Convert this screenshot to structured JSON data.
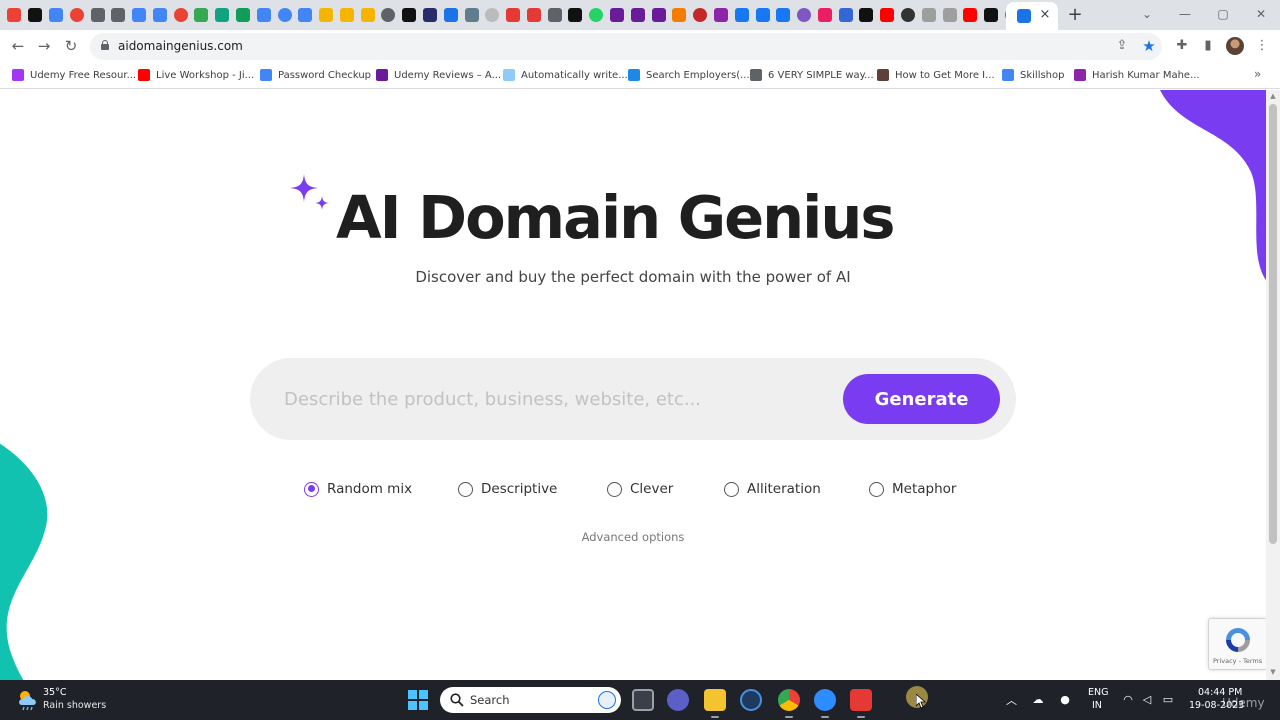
{
  "browser": {
    "tab_favicon_colors": [
      "#ea4335",
      "#111111",
      "#4285f4",
      "#ea4335",
      "#5f6368",
      "#5f6368",
      "#4285f4",
      "#4285f4",
      "#ea4335",
      "#34a853",
      "#10a37f",
      "#0f9d58",
      "#4285f4",
      "#4285f4",
      "#4285f4",
      "#f4b400",
      "#f4b400",
      "#f4b400",
      "#5f6368",
      "#111111",
      "#2b2b6b",
      "#1a73e8",
      "#607d8b",
      "#bbbbbb",
      "#e53935",
      "#e53935",
      "#5f6368",
      "#111111",
      "#25d366",
      "#6a1b9a",
      "#6a1b9a",
      "#6a1b9a",
      "#f57c00",
      "#c62828",
      "#8e24aa",
      "#1877f2",
      "#1877f2",
      "#1877f2",
      "#7e57c2",
      "#e91e63",
      "#3367d6",
      "#111111",
      "#ff0000",
      "#333333",
      "#9e9e9e",
      "#9e9e9e",
      "#ff0000",
      "#111111",
      "#6a5acd"
    ],
    "active_tab_close": "×",
    "new_tab": "+",
    "url": "aidomaingenius.com",
    "bookmarks": [
      {
        "label": "Udemy Free Resour...",
        "color": "#a435f0"
      },
      {
        "label": "Live Workshop - Ji...",
        "color": "#ff0000"
      },
      {
        "label": "Password Checkup",
        "color": "#4285f4"
      },
      {
        "label": "Udemy Reviews – A...",
        "color": "#6a1b9a"
      },
      {
        "label": "Automatically write...",
        "color": "#90caf9"
      },
      {
        "label": "Search Employers(...",
        "color": "#1e88e5"
      },
      {
        "label": "6 VERY SIMPLE way...",
        "color": "#5f6368"
      },
      {
        "label": "How to Get More I...",
        "color": "#5d4037"
      },
      {
        "label": "Skillshop",
        "color": "#4285f4"
      },
      {
        "label": "Harish Kumar Mahe...",
        "color": "#8e24aa"
      }
    ],
    "bookmarks_more": "»"
  },
  "page": {
    "title": "AI Domain Genius",
    "subtitle": "Discover and buy the perfect domain with the power of AI",
    "prompt_placeholder": "Describe the product, business, website, etc...",
    "prompt_value": "",
    "generate_label": "Generate",
    "style_options": [
      {
        "label": "Random mix",
        "selected": true
      },
      {
        "label": "Descriptive",
        "selected": false
      },
      {
        "label": "Clever",
        "selected": false
      },
      {
        "label": "Alliteration",
        "selected": false
      },
      {
        "label": "Metaphor",
        "selected": false
      }
    ],
    "advanced_options_label": "Advanced options",
    "recaptcha_text": "Privacy - Terms",
    "accent_color": "#7a3cf0",
    "teal_color": "#12c2b0"
  },
  "taskbar": {
    "weather_temp": "35°C",
    "weather_desc": "Rain showers",
    "search_label": "Search",
    "language_line1": "ENG",
    "language_line2": "IN",
    "time": "04:44 PM",
    "date": "19-08-2023",
    "watermark": "Udemy"
  }
}
